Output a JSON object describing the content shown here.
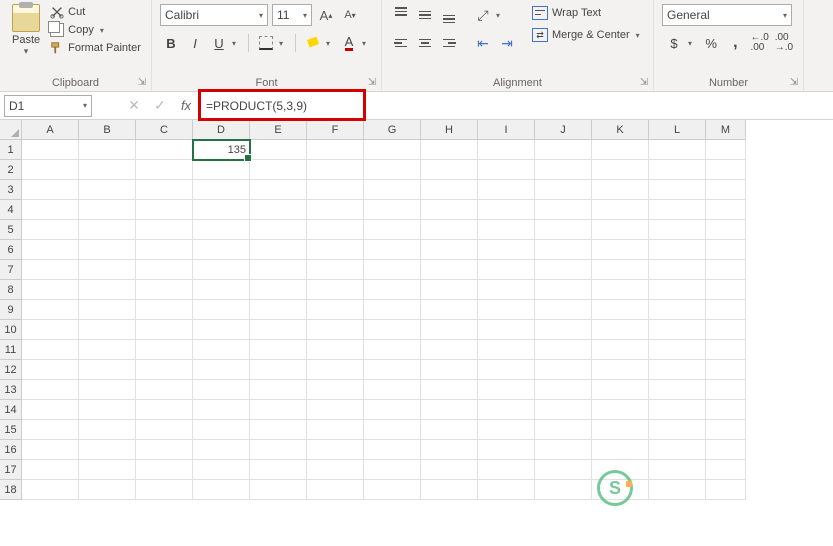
{
  "clipboard": {
    "paste_label": "Paste",
    "cut_label": "Cut",
    "copy_label": "Copy",
    "format_painter_label": "Format Painter",
    "group_label": "Clipboard"
  },
  "font": {
    "name": "Calibri",
    "size": "11",
    "bold": "B",
    "italic": "I",
    "underline": "U",
    "font_color_letter": "A",
    "grow": "A",
    "shrink": "A",
    "group_label": "Font"
  },
  "alignment": {
    "wrap_label": "Wrap Text",
    "merge_label": "Merge & Center",
    "group_label": "Alignment"
  },
  "number": {
    "format": "General",
    "currency": "$",
    "percent": "%",
    "comma": ",",
    "inc_dec": ".0\n.00",
    "dec_dec": ".00\n.0",
    "group_label": "Number"
  },
  "namebox": {
    "value": "D1"
  },
  "formula": {
    "fx": "fx",
    "value": "=PRODUCT(5,3,9)"
  },
  "columns": [
    "A",
    "B",
    "C",
    "D",
    "E",
    "F",
    "G",
    "H",
    "I",
    "J",
    "K",
    "L",
    "M"
  ],
  "rows": [
    "1",
    "2",
    "3",
    "4",
    "5",
    "6",
    "7",
    "8",
    "9",
    "10",
    "11",
    "12",
    "13",
    "14",
    "15",
    "16",
    "17",
    "18"
  ],
  "cells": {
    "D1": "135"
  },
  "watermark": "S"
}
